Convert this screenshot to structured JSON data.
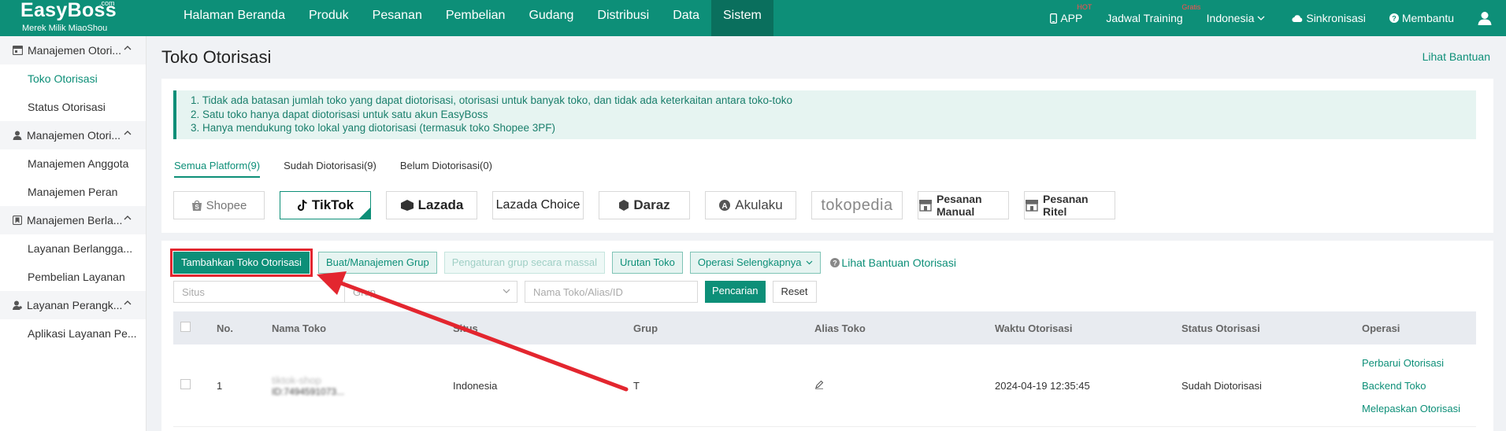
{
  "topbar": {
    "logo_main": "EasyBoss",
    "logo_com": ".com",
    "logo_sub": "Merek Milik MiaoShou",
    "nav": [
      "Halaman Beranda",
      "Produk",
      "Pesanan",
      "Pembelian",
      "Gudang",
      "Distribusi",
      "Data",
      "Sistem"
    ],
    "active_nav": "Sistem",
    "app_label": "APP",
    "app_badge": "HOT",
    "training_label": "Jadwal Training",
    "training_badge": "Gratis",
    "language": "Indonesia",
    "sync_label": "Sinkronisasi",
    "help_label": "Membantu"
  },
  "sidebar": {
    "groups": [
      {
        "label": "Manajemen Otori...",
        "icon": "store-icon",
        "items": [
          "Toko Otorisasi",
          "Status Otorisasi"
        ]
      },
      {
        "label": "Manajemen Otori...",
        "icon": "person-icon",
        "items": [
          "Manajemen Anggota",
          "Manajemen Peran"
        ]
      },
      {
        "label": "Manajemen Berla...",
        "icon": "bookmark-icon",
        "items": [
          "Layanan Berlangga...",
          "Pembelian Layanan"
        ]
      },
      {
        "label": "Layanan Perangk...",
        "icon": "person-gear-icon",
        "items": [
          "Aplikasi Layanan Pe..."
        ]
      }
    ],
    "active_item": "Toko Otorisasi"
  },
  "page": {
    "title": "Toko Otorisasi",
    "help_link": "Lihat Bantuan",
    "notice": [
      "1. Tidak ada batasan jumlah toko yang dapat diotorisasi, otorisasi untuk banyak toko, dan tidak ada keterkaitan antara toko-toko",
      "2. Satu toko hanya dapat diotorisasi untuk satu akun EasyBoss",
      "3. Hanya mendukung toko lokal yang diotorisasi (termasuk toko Shopee 3PF)"
    ],
    "tabs": [
      "Semua Platform(9)",
      "Sudah Diotorisasi(9)",
      "Belum Diotorisasi(0)"
    ],
    "platforms": [
      "Shopee",
      "TikTok",
      "Lazada",
      "Lazada Choice",
      "Daraz",
      "Akulaku",
      "tokopedia",
      "Pesanan Manual",
      "Pesanan Ritel"
    ],
    "selected_platform": "TikTok"
  },
  "actions": {
    "add_store": "Tambahkan Toko Otorisasi",
    "group_manage": "Buat/Manajemen Grup",
    "bulk_group": "Pengaturan grup secara massal",
    "store_order": "Urutan Toko",
    "more_ops": "Operasi Selengkapnya",
    "auth_help": "Lihat Bantuan Otorisasi"
  },
  "filters": {
    "site_placeholder": "Situs",
    "group_placeholder": "Grup",
    "search_placeholder": "Nama Toko/Alias/ID",
    "search_button": "Pencarian",
    "reset_button": "Reset"
  },
  "table": {
    "headers": [
      "No.",
      "Nama Toko",
      "Situs",
      "Grup",
      "Alias Toko",
      "Waktu Otorisasi",
      "Status Otorisasi",
      "Operasi"
    ],
    "rows": [
      {
        "no": "1",
        "store_name": "tiktok-shop",
        "store_id": "ID:7494591073...",
        "site": "Indonesia",
        "group": "T",
        "auth_time": "2024-04-19 12:35:45",
        "status": "Sudah Diotorisasi",
        "ops": [
          "Perbarui Otorisasi",
          "Backend Toko",
          "Melepaskan Otorisasi"
        ]
      }
    ]
  },
  "colors": {
    "brand": "#0d8f78",
    "annotation": "#e3262f"
  }
}
